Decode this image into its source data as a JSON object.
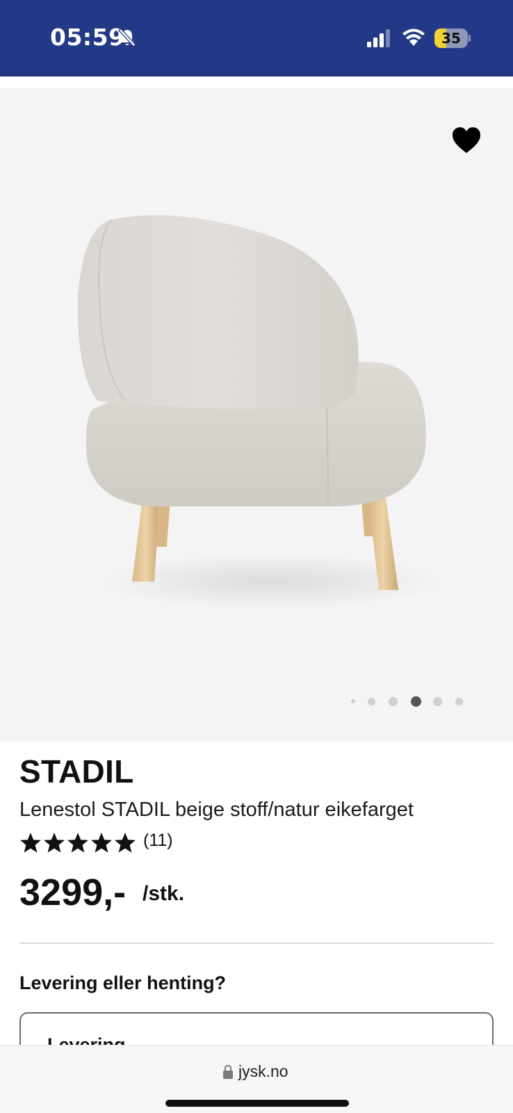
{
  "status_bar": {
    "time": "05:59",
    "battery_level": "35",
    "battery_fraction": 0.35,
    "icons": [
      "bell-muted-icon",
      "cellular-signal-icon",
      "wifi-icon",
      "battery-icon"
    ],
    "background_color": "#233987"
  },
  "gallery": {
    "image_subject": "chair",
    "favorite_icon": "heart-icon",
    "slide_count": 6,
    "active_slide": 4
  },
  "product": {
    "brand": "STADIL",
    "description": "Lenestol STADIL beige stoff/natur eikefarget",
    "rating": 5,
    "rating_max": 5,
    "review_count": "(11)",
    "price": "3299,-",
    "unit": "/stk."
  },
  "delivery": {
    "heading": "Levering eller henting?",
    "option_label": "Levering"
  },
  "browser": {
    "url": "jysk.no",
    "lock_icon": "lock-icon"
  }
}
